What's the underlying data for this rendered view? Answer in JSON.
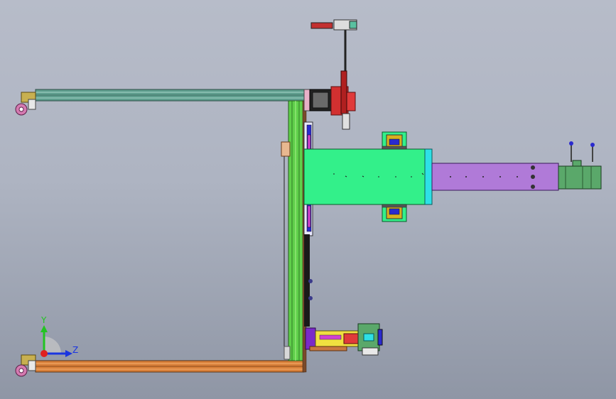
{
  "viewport": {
    "background_top": "#b7bcc9",
    "background_bottom": "#8f96a5"
  },
  "triad": {
    "y_label": "Y",
    "z_label": "Z",
    "y_color": "#22c422",
    "z_color": "#1a35e0",
    "x_color": "#e02020"
  },
  "colors": {
    "top_rail": "#5f9e8e",
    "vertical_rail": "#5fcf4a",
    "bottom_rail": "#d9803a",
    "green_block": "#33f08a",
    "cyan_plate": "#2ee0e6",
    "purple_shaft": "#b07ad8",
    "motor_green": "#5aa86a",
    "red_assembly": "#d23030",
    "caster": "#d47ab0"
  },
  "icons": [
    "coordinate-triad-icon",
    "caster-wheel-icon"
  ]
}
